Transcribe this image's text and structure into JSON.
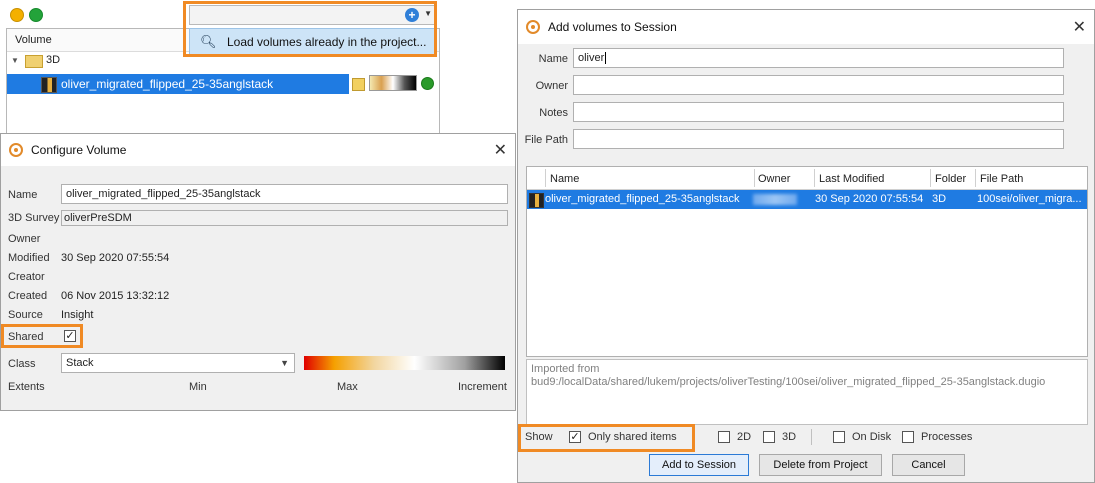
{
  "volume_browser": {
    "search": {
      "value": "",
      "dropdown_item": "Load volumes already in the project..."
    },
    "tree": {
      "header": "Volume",
      "folder": "3D",
      "selected_volume": "oliver_migrated_flipped_25-35anglstack"
    }
  },
  "configure_volume": {
    "title": "Configure Volume",
    "labels": {
      "name": "Name",
      "survey": "3D Survey",
      "owner": "Owner",
      "modified": "Modified",
      "creator": "Creator",
      "created": "Created",
      "source": "Source",
      "shared": "Shared",
      "class": "Class",
      "extents": "Extents",
      "min": "Min",
      "max": "Max",
      "increment": "Increment"
    },
    "values": {
      "name": "oliver_migrated_flipped_25-35anglstack",
      "survey": "oliverPreSDM",
      "owner": "",
      "modified": "30 Sep 2020 07:55:54",
      "creator": "",
      "created": "06 Nov 2015 13:32:12",
      "source": "Insight",
      "shared": true,
      "class": "Stack"
    }
  },
  "add_volumes": {
    "title": "Add volumes to Session",
    "filters": {
      "name_label": "Name",
      "name_value": "oliver",
      "owner_label": "Owner",
      "owner_value": "",
      "notes_label": "Notes",
      "notes_value": "",
      "filepath_label": "File Path",
      "filepath_value": ""
    },
    "table": {
      "columns": [
        "Name",
        "Owner",
        "Last Modified",
        "Folder",
        "File Path"
      ],
      "rows": [
        {
          "name": "oliver_migrated_flipped_25-35anglstack",
          "owner": "",
          "last_modified": "30 Sep 2020 07:55:54",
          "folder": "3D",
          "file_path": "100sei/oliver_migra..."
        }
      ]
    },
    "description": {
      "line1": "Imported from",
      "line2": "bud9:/localData/shared/lukem/projects/oliverTesting/100sei/oliver_migrated_flipped_25-35anglstack.dugio"
    },
    "show": {
      "label": "Show",
      "only_shared": {
        "label": "Only shared items",
        "checked": true
      },
      "d2": {
        "label": "2D",
        "checked": false
      },
      "d3": {
        "label": "3D",
        "checked": false
      },
      "on_disk": {
        "label": "On Disk",
        "checked": false
      },
      "processes": {
        "label": "Processes",
        "checked": false
      }
    },
    "buttons": {
      "add": "Add to Session",
      "delete": "Delete from Project",
      "cancel": "Cancel"
    }
  },
  "colors": {
    "highlight": "#f08a24",
    "selection": "#1f7be2",
    "dropdown_bg": "#cde4f7"
  }
}
